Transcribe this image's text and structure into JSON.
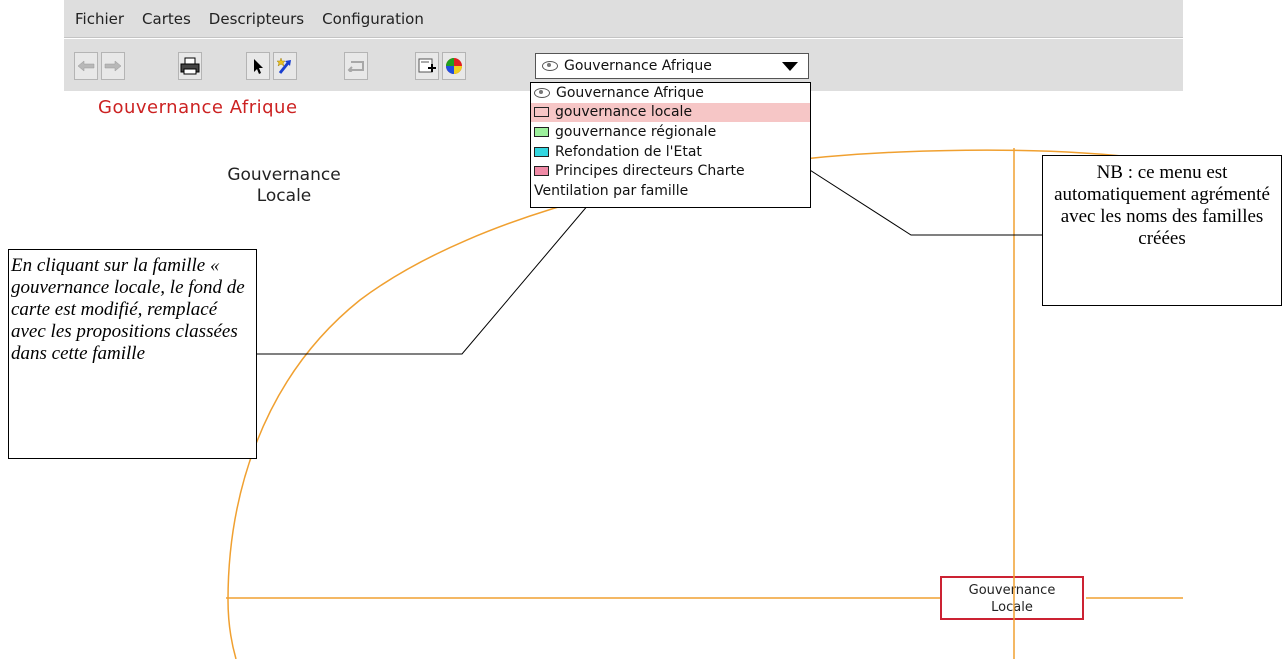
{
  "menu": {
    "items": [
      "Fichier",
      "Cartes",
      "Descripteurs",
      "Configuration"
    ]
  },
  "toolbar": {
    "buttons": [
      "back-arrow-icon",
      "forward-arrow-icon",
      "print-icon",
      "select-pointer-icon",
      "add-link-icon",
      "undo-icon",
      "add-item-icon",
      "globe-icon"
    ]
  },
  "combo": {
    "selected": "Gouvernance Afrique"
  },
  "dropdown": {
    "items": [
      {
        "label": "Gouvernance Afrique",
        "icon": "eye-icon",
        "color": ""
      },
      {
        "label": "gouvernance locale",
        "icon": "swatch",
        "color": "#f6c6c6"
      },
      {
        "label": "gouvernance régionale",
        "icon": "swatch",
        "color": "#9cf09c"
      },
      {
        "label": "Refondation de l'Etat",
        "icon": "swatch",
        "color": "#33d6e0"
      },
      {
        "label": "Principes directeurs Charte",
        "icon": "swatch",
        "color": "#f08aa6"
      },
      {
        "label": "Ventilation par famille",
        "icon": "",
        "color": ""
      }
    ],
    "selected_index": 1
  },
  "canvas": {
    "title": "Gouvernance Afrique",
    "label_line1": "Gouvernance",
    "label_line2": "Locale",
    "node_line1": "Gouvernance",
    "node_line2": "Locale",
    "title_color": "#cc2222",
    "curve_color": "#f0a030"
  },
  "notes": {
    "left": "En cliquant sur la famille « gouvernance locale, le fond de carte est modifié, remplacé avec les propositions classées dans cette famille",
    "right": "NB : ce menu est automatiquement agrémenté avec les noms des familles créées"
  }
}
